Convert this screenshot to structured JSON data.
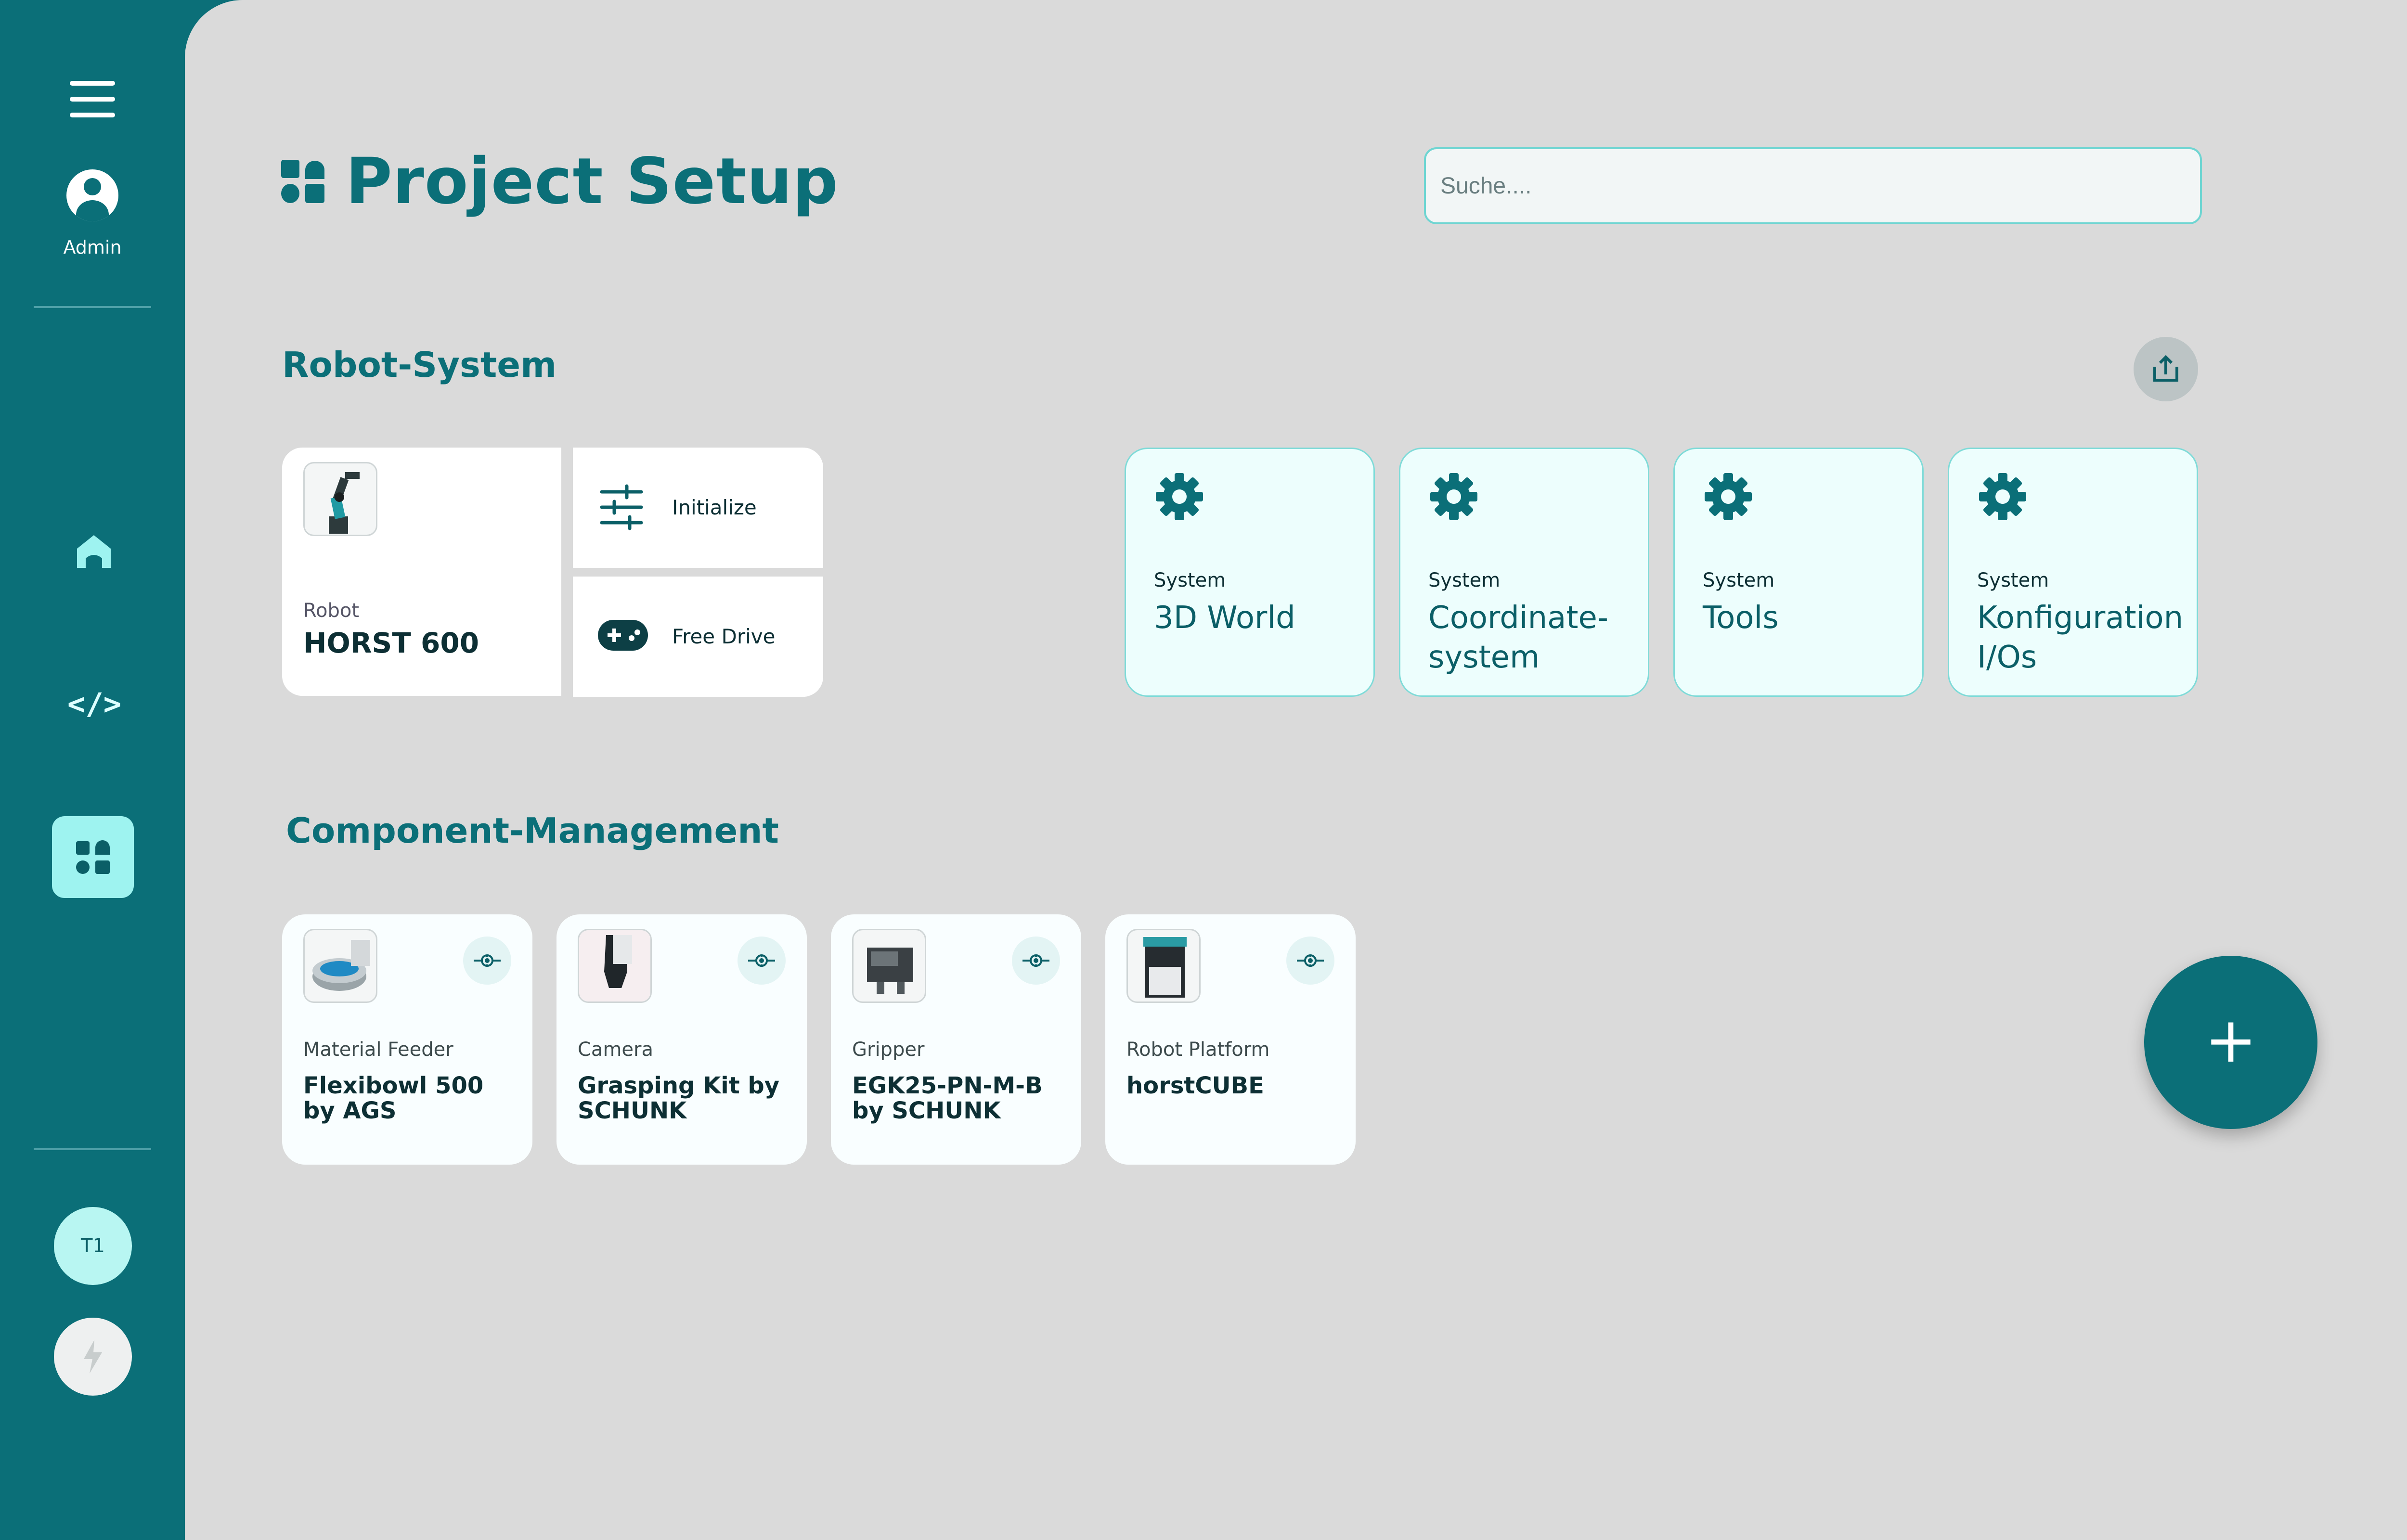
{
  "sidebar": {
    "user_label": "Admin",
    "bottom_badge": "T1"
  },
  "header": {
    "title": "Project Setup",
    "search_placeholder": "Suche...."
  },
  "robot_system": {
    "title": "Robot-System",
    "robot": {
      "type": "Robot",
      "name": "HORST 600"
    },
    "actions": [
      {
        "label": "Initialize"
      },
      {
        "label": "Free Drive"
      }
    ],
    "system_cards": [
      {
        "type": "System",
        "name": "3D World"
      },
      {
        "type": "System",
        "name": "Coordinate-system"
      },
      {
        "type": "System",
        "name": "Tools"
      },
      {
        "type": "System",
        "name": "Konfiguration I/Os"
      }
    ]
  },
  "component_management": {
    "title": "Component-Management",
    "items": [
      {
        "type": "Material Feeder",
        "name": "Flexibowl 500 by AGS"
      },
      {
        "type": "Camera",
        "name": "Grasping Kit by SCHUNK"
      },
      {
        "type": "Gripper",
        "name": "EGK25-PN-M-B by SCHUNK"
      },
      {
        "type": "Robot Platform",
        "name": "horstCUBE"
      }
    ],
    "add_label": "+"
  },
  "colors": {
    "primary": "#0b6f78",
    "accent_light": "#9ef3f0",
    "background": "#dadada"
  }
}
